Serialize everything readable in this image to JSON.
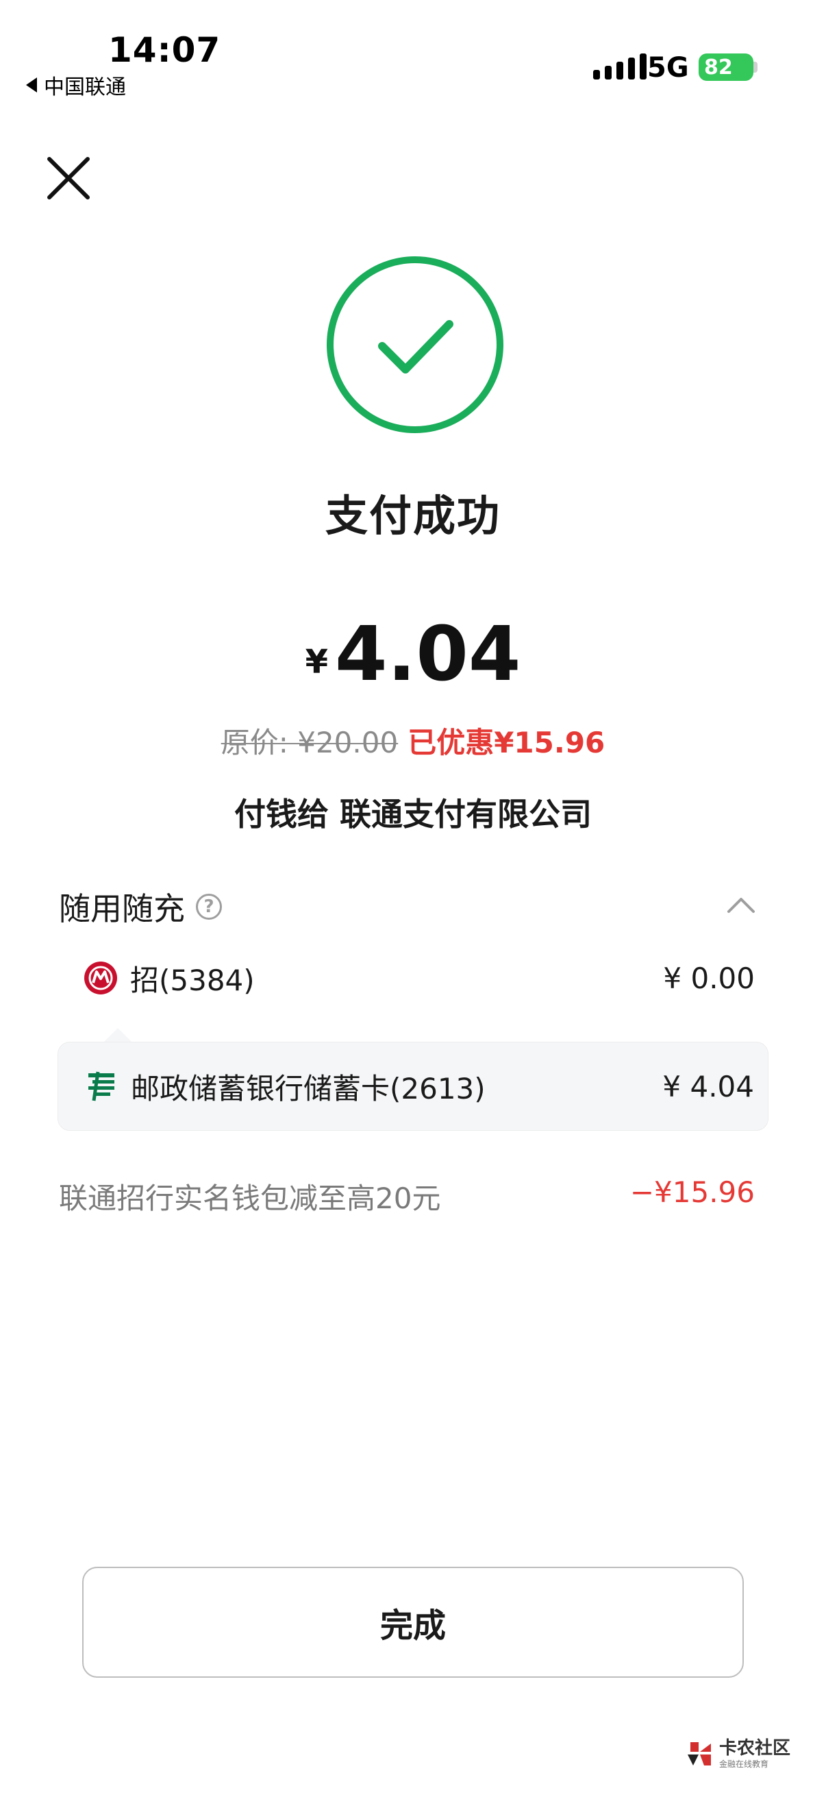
{
  "status_bar": {
    "time": "14:07",
    "carrier": "中国联通",
    "network": "5G",
    "battery": "82"
  },
  "header": {
    "title": "支付成功"
  },
  "amount": {
    "currency": "¥",
    "value": "4.04",
    "original_price": "原价: ¥20.00",
    "discount": "已优惠¥15.96",
    "payee": "付钱给 联通支付有限公司"
  },
  "payment": {
    "section_title": "随用随充",
    "help_glyph": "?",
    "methods": [
      {
        "label": "招(5384)",
        "value": "¥ 0.00"
      },
      {
        "label": "邮政储蓄银行储蓄卡(2613)",
        "value": "¥ 4.04"
      }
    ]
  },
  "promotion": {
    "label": "联通招行实名钱包减至高20元",
    "value": "−¥15.96"
  },
  "actions": {
    "done_label": "完成"
  },
  "watermark": {
    "main": "卡农社区",
    "sub": "金融在线教育"
  },
  "colors": {
    "success": "#1aad5a",
    "discount": "#e53935",
    "psbc": "#0a7b4b",
    "cmb": "#c8102e",
    "battery": "#34c759"
  }
}
